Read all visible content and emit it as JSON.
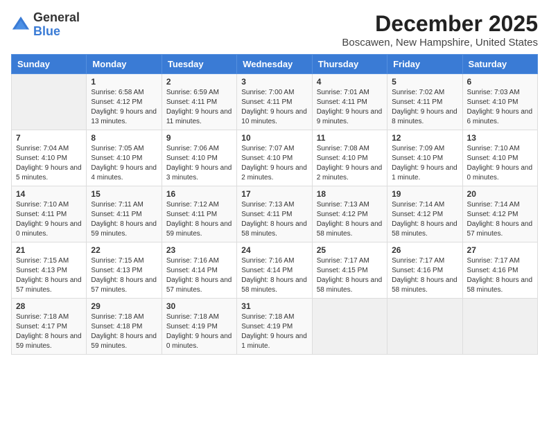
{
  "logo": {
    "general": "General",
    "blue": "Blue"
  },
  "header": {
    "month_year": "December 2025",
    "location": "Boscawen, New Hampshire, United States"
  },
  "days_of_week": [
    "Sunday",
    "Monday",
    "Tuesday",
    "Wednesday",
    "Thursday",
    "Friday",
    "Saturday"
  ],
  "weeks": [
    [
      {
        "day": "",
        "sunrise": "",
        "sunset": "",
        "daylight": ""
      },
      {
        "day": "1",
        "sunrise": "Sunrise: 6:58 AM",
        "sunset": "Sunset: 4:12 PM",
        "daylight": "Daylight: 9 hours and 13 minutes."
      },
      {
        "day": "2",
        "sunrise": "Sunrise: 6:59 AM",
        "sunset": "Sunset: 4:11 PM",
        "daylight": "Daylight: 9 hours and 11 minutes."
      },
      {
        "day": "3",
        "sunrise": "Sunrise: 7:00 AM",
        "sunset": "Sunset: 4:11 PM",
        "daylight": "Daylight: 9 hours and 10 minutes."
      },
      {
        "day": "4",
        "sunrise": "Sunrise: 7:01 AM",
        "sunset": "Sunset: 4:11 PM",
        "daylight": "Daylight: 9 hours and 9 minutes."
      },
      {
        "day": "5",
        "sunrise": "Sunrise: 7:02 AM",
        "sunset": "Sunset: 4:11 PM",
        "daylight": "Daylight: 9 hours and 8 minutes."
      },
      {
        "day": "6",
        "sunrise": "Sunrise: 7:03 AM",
        "sunset": "Sunset: 4:10 PM",
        "daylight": "Daylight: 9 hours and 6 minutes."
      }
    ],
    [
      {
        "day": "7",
        "sunrise": "Sunrise: 7:04 AM",
        "sunset": "Sunset: 4:10 PM",
        "daylight": "Daylight: 9 hours and 5 minutes."
      },
      {
        "day": "8",
        "sunrise": "Sunrise: 7:05 AM",
        "sunset": "Sunset: 4:10 PM",
        "daylight": "Daylight: 9 hours and 4 minutes."
      },
      {
        "day": "9",
        "sunrise": "Sunrise: 7:06 AM",
        "sunset": "Sunset: 4:10 PM",
        "daylight": "Daylight: 9 hours and 3 minutes."
      },
      {
        "day": "10",
        "sunrise": "Sunrise: 7:07 AM",
        "sunset": "Sunset: 4:10 PM",
        "daylight": "Daylight: 9 hours and 2 minutes."
      },
      {
        "day": "11",
        "sunrise": "Sunrise: 7:08 AM",
        "sunset": "Sunset: 4:10 PM",
        "daylight": "Daylight: 9 hours and 2 minutes."
      },
      {
        "day": "12",
        "sunrise": "Sunrise: 7:09 AM",
        "sunset": "Sunset: 4:10 PM",
        "daylight": "Daylight: 9 hours and 1 minute."
      },
      {
        "day": "13",
        "sunrise": "Sunrise: 7:10 AM",
        "sunset": "Sunset: 4:10 PM",
        "daylight": "Daylight: 9 hours and 0 minutes."
      }
    ],
    [
      {
        "day": "14",
        "sunrise": "Sunrise: 7:10 AM",
        "sunset": "Sunset: 4:11 PM",
        "daylight": "Daylight: 9 hours and 0 minutes."
      },
      {
        "day": "15",
        "sunrise": "Sunrise: 7:11 AM",
        "sunset": "Sunset: 4:11 PM",
        "daylight": "Daylight: 8 hours and 59 minutes."
      },
      {
        "day": "16",
        "sunrise": "Sunrise: 7:12 AM",
        "sunset": "Sunset: 4:11 PM",
        "daylight": "Daylight: 8 hours and 59 minutes."
      },
      {
        "day": "17",
        "sunrise": "Sunrise: 7:13 AM",
        "sunset": "Sunset: 4:11 PM",
        "daylight": "Daylight: 8 hours and 58 minutes."
      },
      {
        "day": "18",
        "sunrise": "Sunrise: 7:13 AM",
        "sunset": "Sunset: 4:12 PM",
        "daylight": "Daylight: 8 hours and 58 minutes."
      },
      {
        "day": "19",
        "sunrise": "Sunrise: 7:14 AM",
        "sunset": "Sunset: 4:12 PM",
        "daylight": "Daylight: 8 hours and 58 minutes."
      },
      {
        "day": "20",
        "sunrise": "Sunrise: 7:14 AM",
        "sunset": "Sunset: 4:12 PM",
        "daylight": "Daylight: 8 hours and 57 minutes."
      }
    ],
    [
      {
        "day": "21",
        "sunrise": "Sunrise: 7:15 AM",
        "sunset": "Sunset: 4:13 PM",
        "daylight": "Daylight: 8 hours and 57 minutes."
      },
      {
        "day": "22",
        "sunrise": "Sunrise: 7:15 AM",
        "sunset": "Sunset: 4:13 PM",
        "daylight": "Daylight: 8 hours and 57 minutes."
      },
      {
        "day": "23",
        "sunrise": "Sunrise: 7:16 AM",
        "sunset": "Sunset: 4:14 PM",
        "daylight": "Daylight: 8 hours and 57 minutes."
      },
      {
        "day": "24",
        "sunrise": "Sunrise: 7:16 AM",
        "sunset": "Sunset: 4:14 PM",
        "daylight": "Daylight: 8 hours and 58 minutes."
      },
      {
        "day": "25",
        "sunrise": "Sunrise: 7:17 AM",
        "sunset": "Sunset: 4:15 PM",
        "daylight": "Daylight: 8 hours and 58 minutes."
      },
      {
        "day": "26",
        "sunrise": "Sunrise: 7:17 AM",
        "sunset": "Sunset: 4:16 PM",
        "daylight": "Daylight: 8 hours and 58 minutes."
      },
      {
        "day": "27",
        "sunrise": "Sunrise: 7:17 AM",
        "sunset": "Sunset: 4:16 PM",
        "daylight": "Daylight: 8 hours and 58 minutes."
      }
    ],
    [
      {
        "day": "28",
        "sunrise": "Sunrise: 7:18 AM",
        "sunset": "Sunset: 4:17 PM",
        "daylight": "Daylight: 8 hours and 59 minutes."
      },
      {
        "day": "29",
        "sunrise": "Sunrise: 7:18 AM",
        "sunset": "Sunset: 4:18 PM",
        "daylight": "Daylight: 8 hours and 59 minutes."
      },
      {
        "day": "30",
        "sunrise": "Sunrise: 7:18 AM",
        "sunset": "Sunset: 4:19 PM",
        "daylight": "Daylight: 9 hours and 0 minutes."
      },
      {
        "day": "31",
        "sunrise": "Sunrise: 7:18 AM",
        "sunset": "Sunset: 4:19 PM",
        "daylight": "Daylight: 9 hours and 1 minute."
      },
      {
        "day": "",
        "sunrise": "",
        "sunset": "",
        "daylight": ""
      },
      {
        "day": "",
        "sunrise": "",
        "sunset": "",
        "daylight": ""
      },
      {
        "day": "",
        "sunrise": "",
        "sunset": "",
        "daylight": ""
      }
    ]
  ]
}
